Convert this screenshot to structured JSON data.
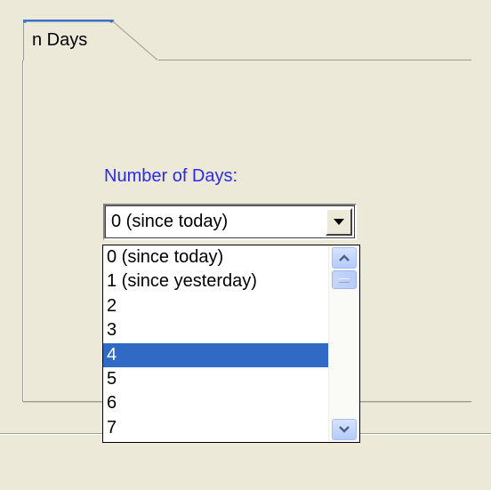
{
  "tab": {
    "label": "n Days",
    "accent_color": "#3C73C8"
  },
  "form": {
    "days_label": "Number of Days:",
    "label_color": "#2A2AF0"
  },
  "combo": {
    "selected_value": "0 (since today)",
    "button_icon": "chevron-down-icon"
  },
  "dropdown": {
    "highlight_color": "#316AC5",
    "highlighted_index": 4,
    "options": [
      "0 (since today)",
      "1 (since yesterday)",
      "2",
      "3",
      "4",
      "5",
      "6",
      "7"
    ],
    "scrollbar": {
      "up_icon": "scroll-up-icon",
      "down_icon": "scroll-down-icon",
      "position": 0
    }
  }
}
